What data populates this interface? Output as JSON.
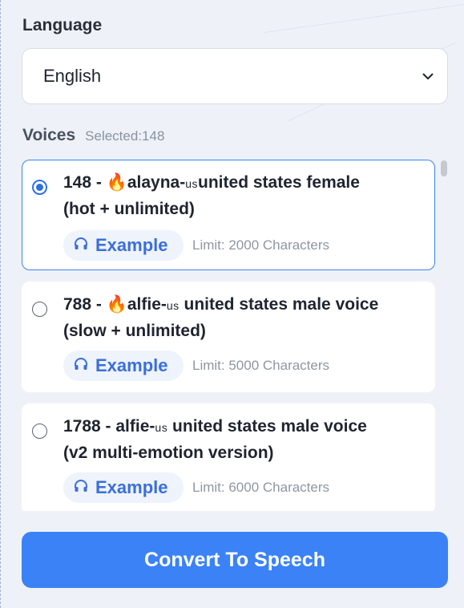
{
  "language": {
    "label": "Language",
    "selected": "English"
  },
  "voices": {
    "title": "Voices",
    "selected_text": "Selected:148",
    "example_label": "Example",
    "items": [
      {
        "id_prefix": "148 - ",
        "name": "alayna-",
        "region": "us",
        "desc": "united states female",
        "line2": "(hot + unlimited)",
        "limit": "Limit: 2000 Characters",
        "selected": true
      },
      {
        "id_prefix": "788 - ",
        "name": "alfie-",
        "region": "us",
        "desc": " united states male voice",
        "line2": "(slow + unlimited)",
        "limit": "Limit: 5000 Characters",
        "selected": false
      },
      {
        "id_prefix": "1788 - alfie-",
        "name": "",
        "region": "us",
        "desc": " united states male voice",
        "line2": "(v2 multi-emotion version)",
        "limit": "Limit: 6000 Characters",
        "selected": false
      }
    ]
  },
  "convert_button": "Convert To Speech",
  "colors": {
    "accent": "#3b82f6",
    "background": "#eef2f8",
    "card": "#ffffff"
  },
  "icons": {
    "fire": "fire-icon",
    "headphones": "headphones-icon",
    "chevron": "chevron-down-icon"
  }
}
